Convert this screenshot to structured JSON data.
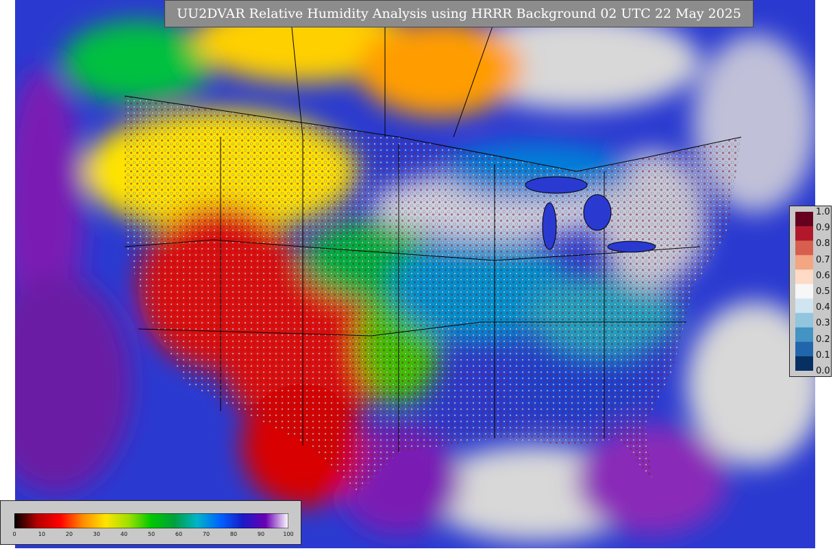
{
  "title": "UU2DVAR Relative Humidity Analysis using HRRR Background 02 UTC 22 May 2025",
  "map": {
    "type": "weather-analysis-map",
    "variable": "relative humidity",
    "region": "Contiguous United States",
    "features": [
      "state-borders",
      "coastlines",
      "great-lakes",
      "observation-stations"
    ],
    "dominant_colors": {
      "very_dry": "#d40000",
      "dry": "#ff8c00",
      "moderate": "#ffe400",
      "mid": "#00b000",
      "moist": "#0096d8",
      "wet": "#1a2ad8",
      "very_wet": "#7a1ab4",
      "saturated": "#d8d8d8"
    }
  },
  "station_colorbar": {
    "labels": [
      "1.0",
      "0.9",
      "0.8",
      "0.7",
      "0.6",
      "0.5",
      "0.4",
      "0.3",
      "0.2",
      "0.1",
      "0.0"
    ],
    "colors": [
      "#67001f",
      "#b2182b",
      "#d6604d",
      "#f4a582",
      "#fddbc7",
      "#f7f7f7",
      "#d1e5f0",
      "#92c5de",
      "#4393c3",
      "#2166ac",
      "#053061"
    ]
  },
  "field_colorbar": {
    "labels": [
      "0",
      "10",
      "20",
      "30",
      "40",
      "50",
      "60",
      "70",
      "80",
      "90",
      "100"
    ],
    "colors": [
      "#000000",
      "#b40000",
      "#ff0000",
      "#ff8c00",
      "#ffe400",
      "#a0e000",
      "#00c800",
      "#00a03c",
      "#00b4c8",
      "#0064ff",
      "#1a1ac8",
      "#6a00b4",
      "#ffffff"
    ]
  }
}
